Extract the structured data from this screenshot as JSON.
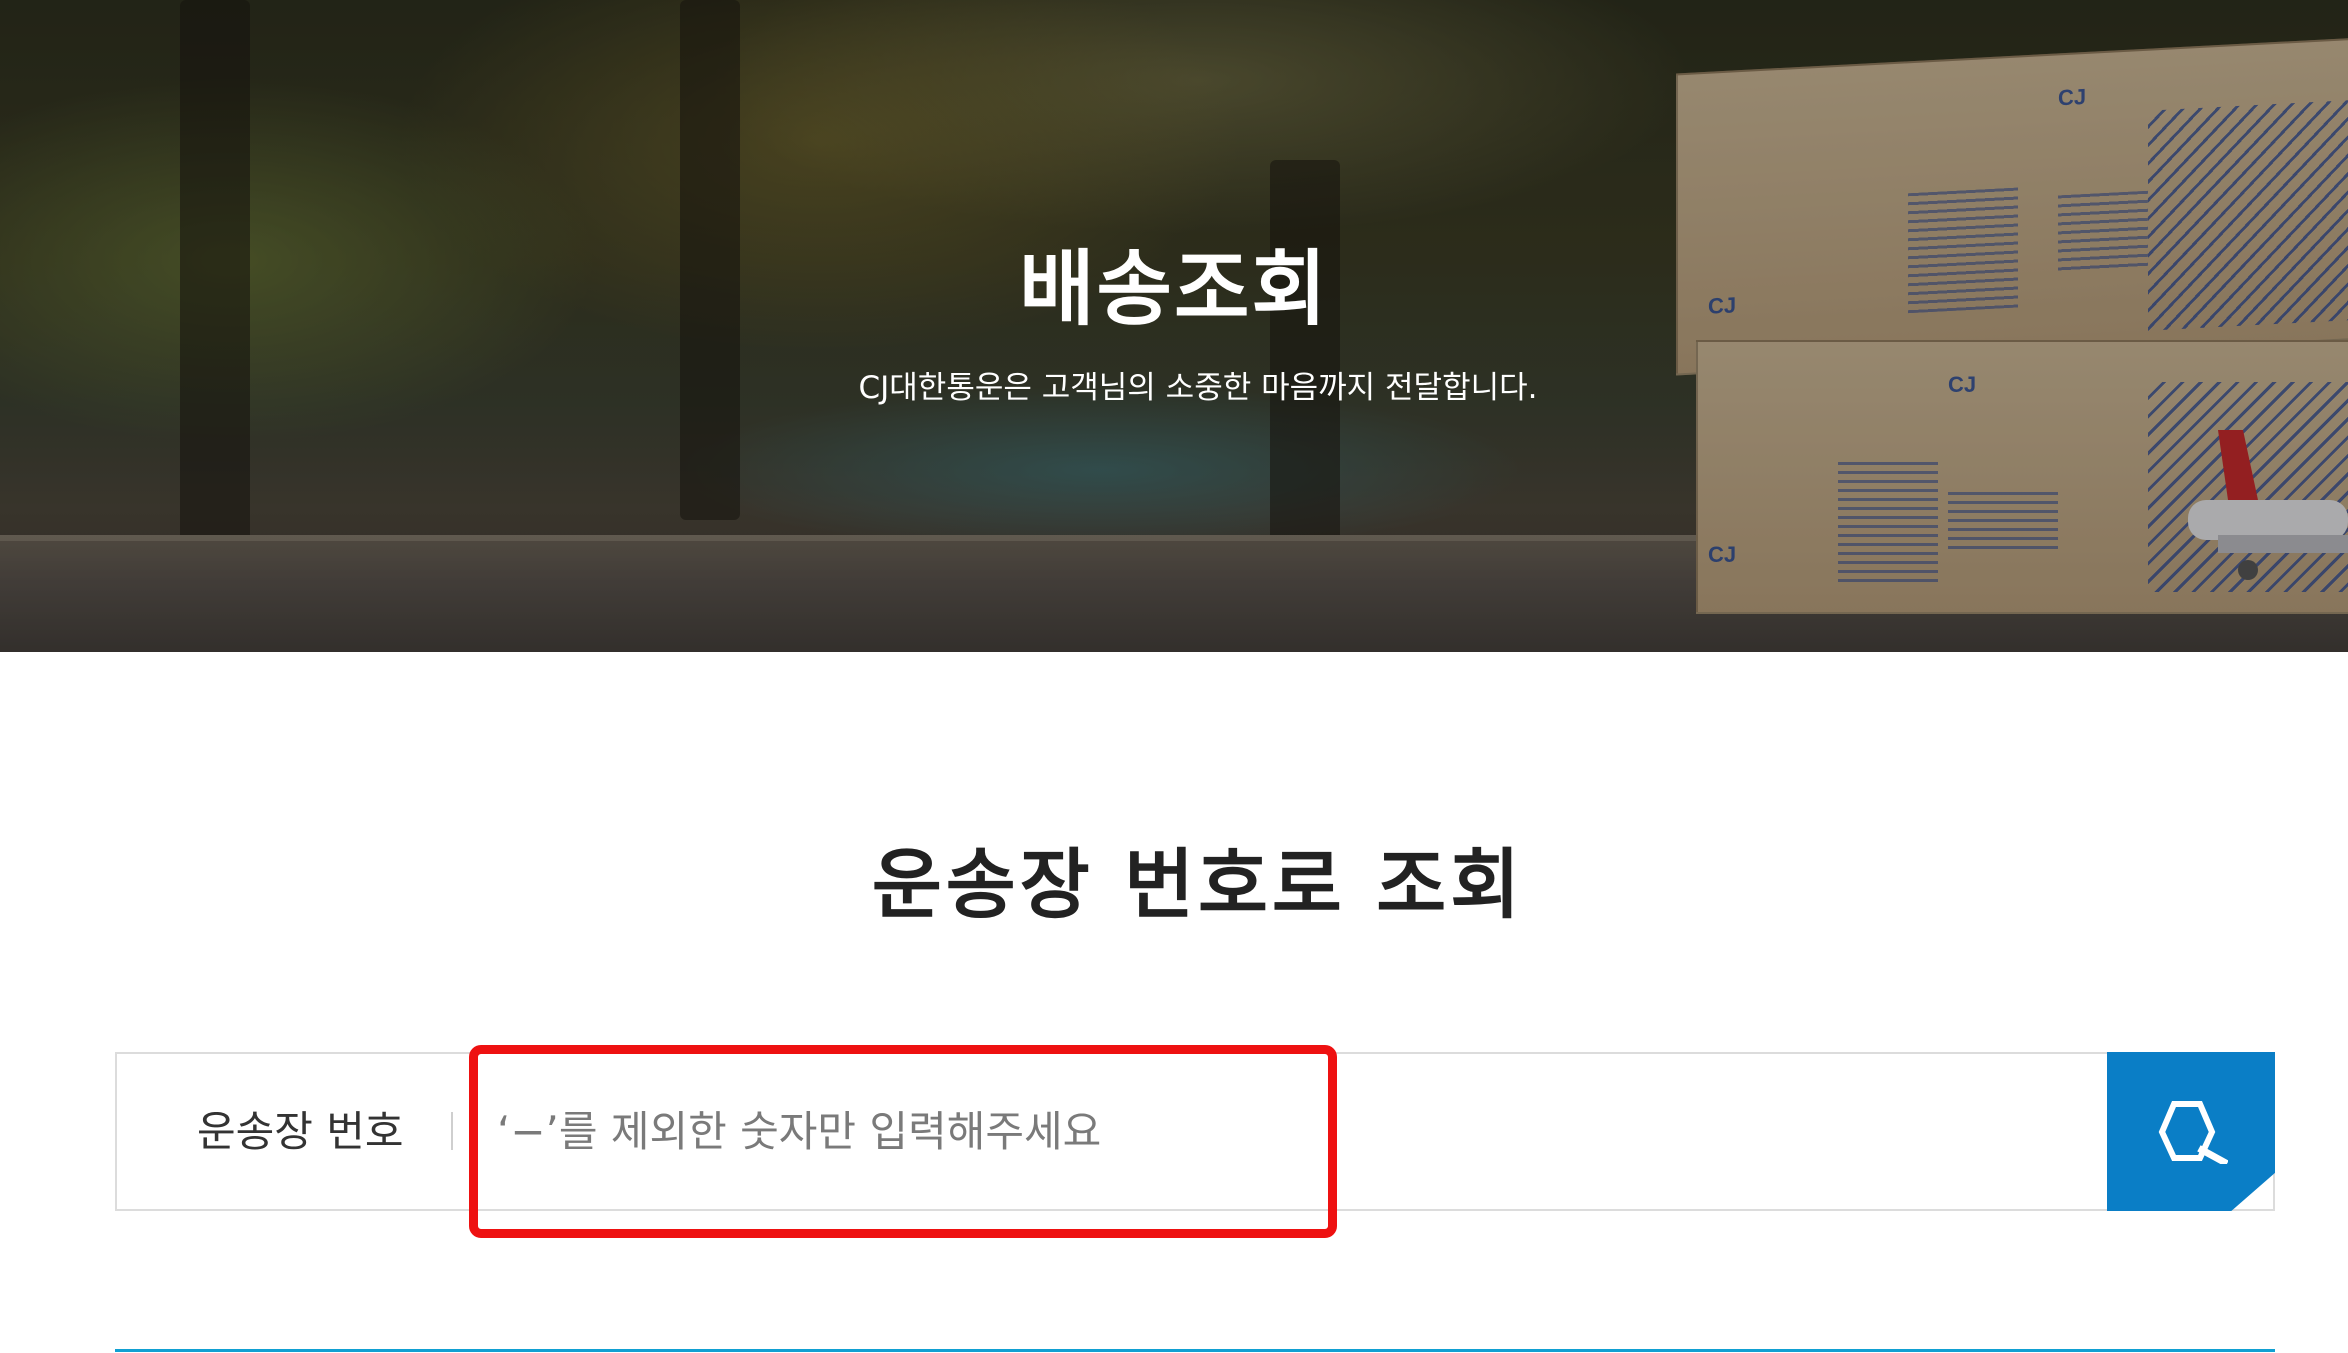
{
  "hero": {
    "title": "배송조회",
    "subtitle": "CJ대한통운은 고객님의 소중한 마음까지 전달합니다.",
    "box_brand": "CJ"
  },
  "tracking": {
    "section_title": "운송장 번호로 조회",
    "label": "운송장 번호",
    "placeholder": "‘−’를 제외한 숫자만 입력해주세요",
    "value": ""
  },
  "icons": {
    "search_button": "search-icon"
  },
  "colors": {
    "accent_blue": "#0a7ec6",
    "bottom_line": "#11a0d2",
    "highlight_red": "#ee1111"
  }
}
